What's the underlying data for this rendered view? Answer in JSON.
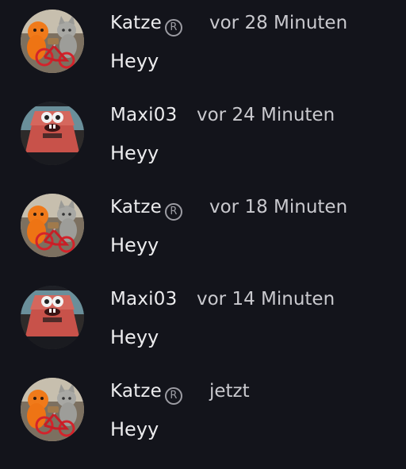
{
  "messages": [
    {
      "user": "Katze",
      "verified": true,
      "verified_icon": "registered-badge-icon",
      "time": "vor 28 Minuten",
      "text": "Heyy",
      "avatar": "cat-bicycle-avatar"
    },
    {
      "user": "Maxi03",
      "verified": false,
      "time": "vor 24 Minuten",
      "text": "Heyy",
      "avatar": "meme-face-avatar"
    },
    {
      "user": "Katze",
      "verified": true,
      "verified_icon": "registered-badge-icon",
      "time": "vor 18 Minuten",
      "text": "Heyy",
      "avatar": "cat-bicycle-avatar"
    },
    {
      "user": "Maxi03",
      "verified": false,
      "time": "vor 14 Minuten",
      "text": "Heyy",
      "avatar": "meme-face-avatar"
    },
    {
      "user": "Katze",
      "verified": true,
      "verified_icon": "registered-badge-icon",
      "time": "jetzt",
      "text": "Heyy",
      "avatar": "cat-bicycle-avatar"
    }
  ],
  "badge_symbol": "R",
  "colors": {
    "background": "#13141b",
    "username": "#ececee",
    "timestamp": "#c9c9ce",
    "badge": "#9c9ca3"
  }
}
